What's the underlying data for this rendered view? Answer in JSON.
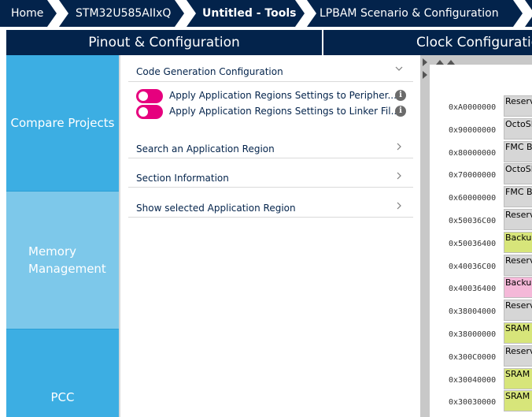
{
  "breadcrumb": {
    "items": [
      {
        "label": "Home",
        "bold": false
      },
      {
        "label": "STM32U585AIIxQ",
        "bold": false
      },
      {
        "label": "Untitled - Tools",
        "bold": true
      },
      {
        "label": "LPBAM Scenario & Configuration",
        "bold": false
      }
    ]
  },
  "tabs": [
    {
      "label": "Pinout & Configuration"
    },
    {
      "label": "Clock Configuration"
    }
  ],
  "sidebar": {
    "items": [
      {
        "label": "Compare Projects",
        "color": "#3caee3"
      },
      {
        "label": "Memory Management",
        "color": "#7dc8ea"
      },
      {
        "label": "PCC",
        "color": "#3caee3"
      }
    ]
  },
  "config": {
    "sections": [
      {
        "title": "Code Generation Configuration",
        "chevron": "down"
      },
      {
        "title": "Search an Application Region",
        "chevron": "right"
      },
      {
        "title": "Section Information",
        "chevron": "right"
      },
      {
        "title": "Show selected Application Region",
        "chevron": "right"
      }
    ],
    "toggles": [
      {
        "label": "Apply Application Regions Settings to Peripher...",
        "on": true
      },
      {
        "label": "Apply Application Regions Settings to Linker Fil...",
        "on": true
      }
    ],
    "info_glyph": "i"
  },
  "memory_map": {
    "rows": [
      {
        "address": "0xA0000000",
        "region": "Reserved",
        "color": "#d6d6d6"
      },
      {
        "address": "0x90000000",
        "region": "OctoSPI",
        "color": "#d6d6d6"
      },
      {
        "address": "0x80000000",
        "region": "FMC Bank",
        "color": "#d6d6d6"
      },
      {
        "address": "0x70000000",
        "region": "OctoSPI",
        "color": "#d6d6d6"
      },
      {
        "address": "0x60000000",
        "region": "FMC Bank",
        "color": "#d6d6d6"
      },
      {
        "address": "0x50036C00",
        "region": "Reserved",
        "color": "#d6d6d6"
      },
      {
        "address": "0x50036400",
        "region": "Backup",
        "color": "#d7e57a"
      },
      {
        "address": "0x40036C00",
        "region": "Reserved",
        "color": "#d6d6d6"
      },
      {
        "address": "0x40036400",
        "region": "Backup",
        "color": "#f4b8d8"
      },
      {
        "address": "0x38004000",
        "region": "Reserved",
        "color": "#d6d6d6"
      },
      {
        "address": "0x38000000",
        "region": "SRAM",
        "color": "#d7e57a"
      },
      {
        "address": "0x300C0000",
        "region": "Reserved",
        "color": "#d6d6d6"
      },
      {
        "address": "0x30040000",
        "region": "SRAM",
        "color": "#d7e57a"
      },
      {
        "address": "0x30030000",
        "region": "SRAM",
        "color": "#d7e57a"
      }
    ]
  }
}
